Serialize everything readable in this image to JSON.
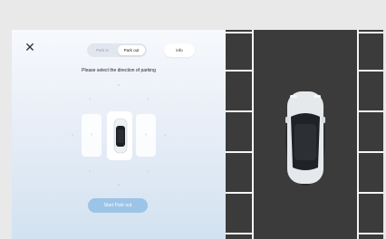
{
  "header": {
    "close_glyph": "✕",
    "mode_options": [
      {
        "label": "Park in",
        "selected": false
      },
      {
        "label": "Park out",
        "selected": true
      }
    ],
    "info_label": "info"
  },
  "main": {
    "instruction": "Please select the direction of parking",
    "start_button_label": "Start Park out"
  },
  "icons": {
    "close": "close-icon",
    "arrow": "chevron-icon",
    "car": "car-icon"
  },
  "colors": {
    "accent": "#9cc4e6",
    "asphalt": "#3b3b3b",
    "lane_lines": "#f5f5f5",
    "car_body": "#e6e9ec"
  }
}
